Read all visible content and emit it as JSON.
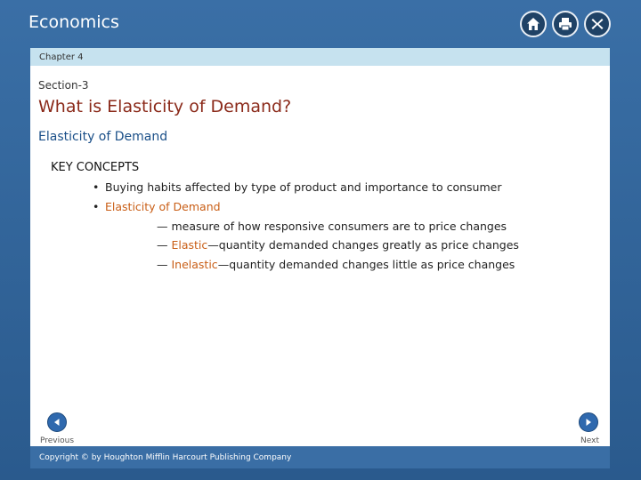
{
  "header": {
    "title": "Economics",
    "icons": [
      "home-icon",
      "print-icon",
      "close-icon"
    ]
  },
  "chapter_label": "Chapter 4",
  "section_label": "Section-3",
  "title": "What is Elasticity of Demand?",
  "subtitle": "Elasticity of Demand",
  "key_concepts": {
    "heading": "KEY CONCEPTS",
    "bullet1": "Buying habits affected by type of product and importance to consumer",
    "bullet2": "Elasticity of Demand",
    "line1": "— measure of how responsive consumers are to price changes",
    "line2_dash": "— ",
    "line2_term": "Elastic",
    "line2_rest": "—quantity demanded changes greatly as price changes",
    "line3_dash": "— ",
    "line3_term": "Inelastic",
    "line3_rest": "—quantity demanded changes little as price changes"
  },
  "nav": {
    "previous": "Previous",
    "next": "Next"
  },
  "footer": {
    "copyright": "Copyright © by Houghton Mifflin Harcourt Publishing Company"
  },
  "colors": {
    "title": "#8b2a1a",
    "subtitle": "#1a4f88",
    "highlight": "#c95e16",
    "frame": "#2d5e90",
    "chapter_bar": "#c6e2ef"
  }
}
